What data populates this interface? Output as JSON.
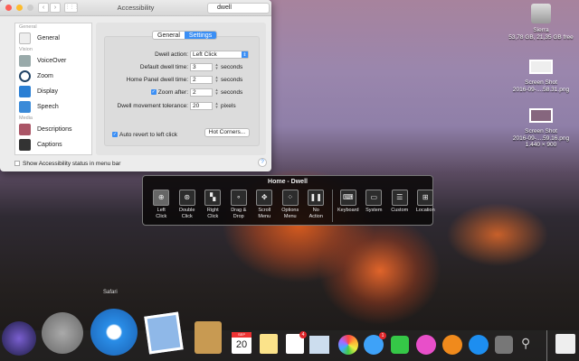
{
  "window": {
    "title": "Accessibility",
    "search_value": "dwell",
    "nav_back": "‹",
    "nav_fwd": "›",
    "grid": "⋮⋮⋮"
  },
  "sidebar": {
    "headers": [
      "General",
      "Vision",
      "Media"
    ],
    "items": [
      {
        "label": "General"
      },
      {
        "label": "VoiceOver"
      },
      {
        "label": "Zoom"
      },
      {
        "label": "Display"
      },
      {
        "label": "Speech"
      },
      {
        "label": "Descriptions"
      },
      {
        "label": "Captions"
      }
    ]
  },
  "tabs": [
    "General",
    "Settings"
  ],
  "settings": {
    "dwell_action_label": "Dwell action:",
    "dwell_action_value": "Left Click",
    "default_dwell_label": "Default dwell time:",
    "default_dwell_value": "3",
    "seconds": "seconds",
    "home_panel_label": "Home Panel dwell time:",
    "home_panel_value": "2",
    "zoom_after_label": "Zoom after:",
    "zoom_after_value": "2",
    "tolerance_label": "Dwell movement tolerance:",
    "tolerance_value": "20",
    "pixels": "pixels",
    "auto_revert_label": "Auto revert to left click",
    "hot_corners": "Hot Corners...",
    "show_status_label": "Show Accessibility status in menu bar",
    "help": "?"
  },
  "dwell_panel": {
    "title": "Home - Dwell",
    "items": [
      {
        "l1": "Left",
        "l2": "Click",
        "icon": "⊕"
      },
      {
        "l1": "Double",
        "l2": "Click",
        "icon": "⊛"
      },
      {
        "l1": "Right",
        "l2": "Click",
        "icon": "▚"
      },
      {
        "l1": "Drag &",
        "l2": "Drop",
        "icon": "∘"
      },
      {
        "l1": "Scroll",
        "l2": "Menu",
        "icon": "✥"
      },
      {
        "l1": "Options",
        "l2": "Menu",
        "icon": "⁘"
      },
      {
        "l1": "No",
        "l2": "Action",
        "icon": "❚❚"
      }
    ],
    "items2": [
      {
        "l1": "Keyboard",
        "icon": "⌨"
      },
      {
        "l1": "System",
        "icon": "▭"
      },
      {
        "l1": "Custom",
        "icon": "☰"
      },
      {
        "l1": "Location",
        "icon": "⊞"
      }
    ]
  },
  "desktop": [
    {
      "name": "Sierra",
      "sub": "53,78 GB, 21,35 GB free"
    },
    {
      "name": "Screen Shot",
      "sub": "2016-09-....58.31.png"
    },
    {
      "name": "Screen Shot",
      "sub": "2016-09-....59.16.png",
      "sub2": "1.440 × 900"
    }
  ],
  "dock": {
    "tooltip": "Safari",
    "calendar_month": "SEP",
    "calendar_day": "20",
    "reminders_badge": "4",
    "messages_badge": "1"
  }
}
